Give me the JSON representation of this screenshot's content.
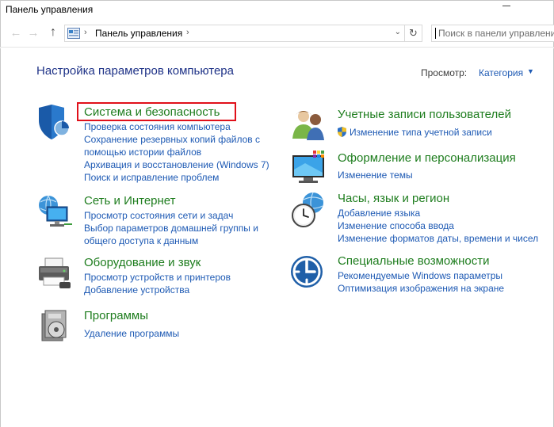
{
  "window": {
    "title": "Панель управления"
  },
  "nav": {
    "address": "Панель управления",
    "search_placeholder": "Поиск в панели управления"
  },
  "header": {
    "heading": "Настройка параметров компьютера",
    "view_label": "Просмотр:",
    "view_value": "Категория"
  },
  "categories": {
    "system": {
      "title": "Система и безопасность",
      "links": [
        "Проверка состояния компьютера",
        "Сохранение резервных копий файлов с помощью истории файлов",
        "Архивация и восстановление (Windows 7)",
        "Поиск и исправление проблем"
      ]
    },
    "network": {
      "title": "Сеть и Интернет",
      "links": [
        "Просмотр состояния сети и задач",
        "Выбор параметров домашней группы и общего доступа к данным"
      ]
    },
    "hardware": {
      "title": "Оборудование и звук",
      "links": [
        "Просмотр устройств и принтеров",
        "Добавление устройства"
      ]
    },
    "programs": {
      "title": "Программы",
      "links": [
        "Удаление программы"
      ]
    },
    "users": {
      "title": "Учетные записи пользователей",
      "links": [
        "Изменение типа учетной записи"
      ]
    },
    "appearance": {
      "title": "Оформление и персонализация",
      "links": [
        "Изменение темы"
      ]
    },
    "clock": {
      "title": "Часы, язык и регион",
      "links": [
        "Добавление языка",
        "Изменение способа ввода",
        "Изменение форматов даты, времени и чисел"
      ]
    },
    "access": {
      "title": "Специальные возможности",
      "links": [
        "Рекомендуемые Windows параметры",
        "Оптимизация изображения на экране"
      ]
    }
  },
  "colors": {
    "category_title": "#1e7d1e",
    "link": "#1e5ab4",
    "heading": "#1e3287",
    "highlight": "#e0101a"
  }
}
